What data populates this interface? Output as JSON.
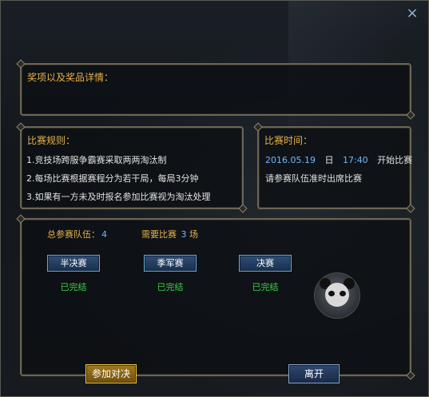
{
  "window": {
    "close_icon": "×"
  },
  "awards": {
    "title": "奖项以及奖品详情："
  },
  "rules": {
    "title": "比赛规则：",
    "lines": [
      "1.竞技场跨服争霸赛采取两两淘汰制",
      "2.每场比赛根据赛程分为若干局，每局3分钟",
      "3.如果有一方未及时报名参加比赛视为淘汰处理"
    ]
  },
  "time": {
    "title": "比赛时间：",
    "date": "2016.05.19",
    "day_label": "日",
    "clock": "17:40",
    "start_label": "开始比赛",
    "notice": "请参赛队伍准时出席比赛"
  },
  "stage": {
    "teams_label": "总参赛队伍：",
    "teams_value": "4",
    "matches_label": "需要比赛",
    "matches_value": "3",
    "matches_unit": "场",
    "rounds": [
      {
        "label": "半决赛",
        "status": "已完结"
      },
      {
        "label": "季军赛",
        "status": "已完结"
      },
      {
        "label": "决赛",
        "status": "已完结"
      }
    ]
  },
  "footer": {
    "join_label": "参加对决",
    "leave_label": "离开"
  },
  "colors": {
    "title_gold": "#e7b24a",
    "value_blue": "#6fb8ff",
    "status_green": "#3fd34a"
  }
}
